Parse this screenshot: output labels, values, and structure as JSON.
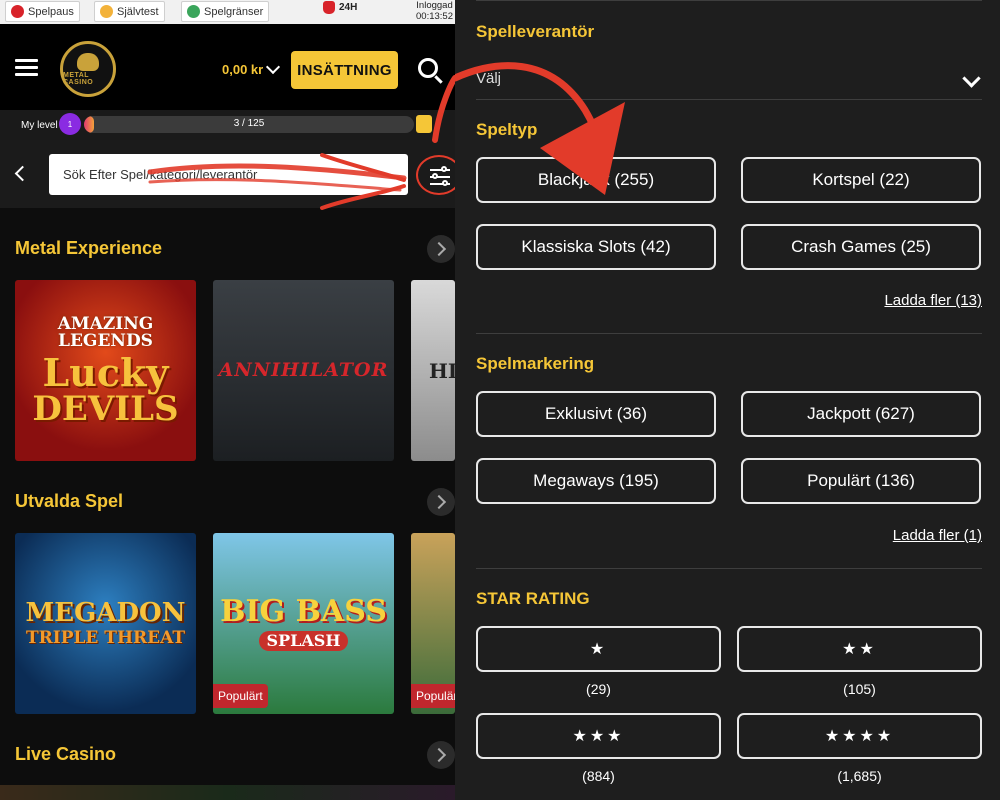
{
  "topbar": {
    "spelpaus": "Spelpaus",
    "sjalvtest": "Självtest",
    "spelgranser": "Spelgränser",
    "hours": "24H",
    "logged_label": "Inloggad",
    "logged_time": "00:13:52"
  },
  "header": {
    "logo_text": "METAL CASINO",
    "balance": "0,00 kr",
    "deposit_label": "INSÄTTNING"
  },
  "level": {
    "label": "My level",
    "badge": "1",
    "progress_text": "3 / 125",
    "progress_fraction": 0.024
  },
  "search": {
    "placeholder": "Sök Efter Spel/kategori/leverantör"
  },
  "sections": [
    {
      "title": "Metal Experience",
      "tiles": [
        {
          "line1": "AMAZING LEGENDS",
          "line2": "Lucky",
          "line3": "DEVILS",
          "badge": ""
        },
        {
          "line1": "ANNIHILATOR",
          "line2": "",
          "line3": "",
          "badge": ""
        },
        {
          "line1": "HI",
          "line2": "",
          "line3": "",
          "badge": ""
        }
      ]
    },
    {
      "title": "Utvalda Spel",
      "tiles": [
        {
          "line1": "MEGADON",
          "line2": "TRIPLE THREAT",
          "line3": "",
          "badge": ""
        },
        {
          "line1": "BIG BASS",
          "line2": "SPLASH",
          "line3": "",
          "badge": "Populärt"
        },
        {
          "line1": "",
          "line2": "",
          "line3": "",
          "badge": "Populär"
        }
      ]
    },
    {
      "title": "Live Casino",
      "tiles": []
    }
  ],
  "filters": {
    "provider": {
      "title": "Spelleverantör",
      "value": "Välj"
    },
    "game_type": {
      "title": "Speltyp",
      "options": [
        {
          "label": "Blackjack (255)"
        },
        {
          "label": "Kortspel (22)"
        },
        {
          "label": "Klassiska Slots (42)"
        },
        {
          "label": "Crash Games (25)"
        }
      ],
      "more": "Ladda fler (13)"
    },
    "marking": {
      "title": "Spelmarkering",
      "options": [
        {
          "label": "Exklusivt (36)"
        },
        {
          "label": "Jackpott (627)"
        },
        {
          "label": "Megaways (195)"
        },
        {
          "label": "Populärt (136)"
        }
      ],
      "more": "Ladda fler (1)"
    },
    "rating": {
      "title": "STAR RATING",
      "options": [
        {
          "stars": "★",
          "count": "(29)"
        },
        {
          "stars": "★★",
          "count": "(105)"
        },
        {
          "stars": "★★★",
          "count": "(884)"
        },
        {
          "stars": "★★★★",
          "count": "(1,685)"
        }
      ]
    }
  },
  "colors": {
    "accent": "#f5c637",
    "annotation": "#e23b2a",
    "badge": "#c0272d"
  }
}
